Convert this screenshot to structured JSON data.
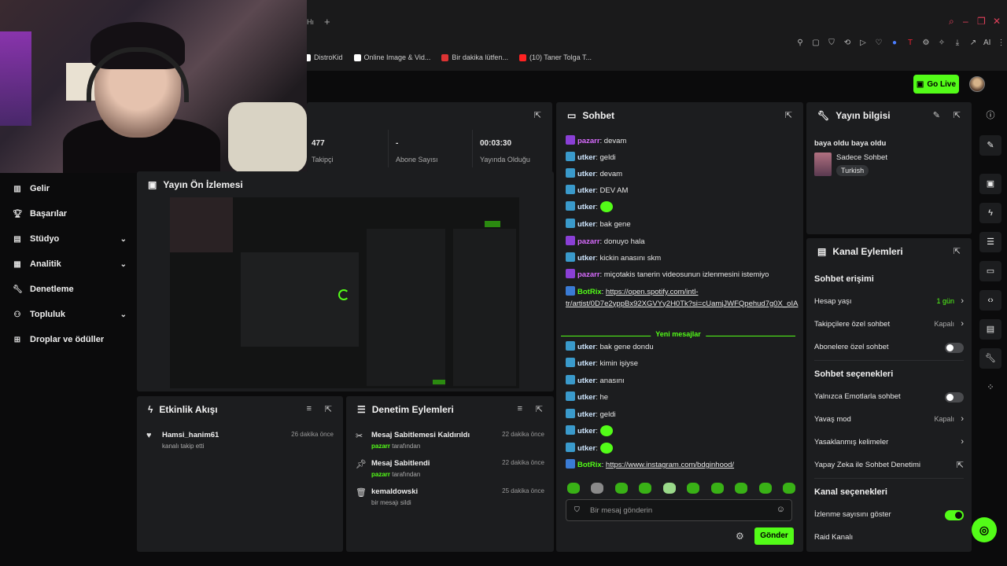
{
  "browser": {
    "tab_label": "Hı",
    "bookmarks": [
      {
        "label": "DistroKid",
        "color": "#ffffff"
      },
      {
        "label": "Online Image & Vid...",
        "color": "#ffffff"
      },
      {
        "label": "Bir dakika lütfen...",
        "color": "#d33"
      },
      {
        "label": "(10) Taner Tolga T...",
        "color": "#f22"
      }
    ],
    "toolbar_ai": "AI"
  },
  "header": {
    "go_live": "Go Live"
  },
  "nav": {
    "items": [
      {
        "label": "Gelir",
        "icon": "bar-chart-icon",
        "expand": false
      },
      {
        "label": "Başarılar",
        "icon": "trophy-icon",
        "expand": false
      },
      {
        "label": "Stüdyo",
        "icon": "studio-icon",
        "expand": true
      },
      {
        "label": "Analitik",
        "icon": "analytics-icon",
        "expand": true
      },
      {
        "label": "Denetleme",
        "icon": "wrench-icon",
        "expand": false
      },
      {
        "label": "Topluluk",
        "icon": "community-icon",
        "expand": true
      },
      {
        "label": "Droplar ve ödüller",
        "icon": "gift-icon",
        "expand": false
      }
    ]
  },
  "stats": {
    "followers_value": "477",
    "followers_label": "Takipçi",
    "subs_value": "-",
    "subs_label": "Abone Sayısı",
    "live_value": "00:03:30",
    "live_label": "Yayında Olduğu"
  },
  "preview": {
    "title": "Yayın Ön İzlemesi"
  },
  "events": {
    "title": "Etkinlik Akışı",
    "rows": [
      {
        "title": "Hamsi_hanim61",
        "sub": "kanalı takip etti",
        "time": "26 dakika önce"
      }
    ]
  },
  "modlog": {
    "title": "Denetim Eylemleri",
    "by_suffix": "tarafından",
    "rows": [
      {
        "title": "Mesaj Sabitlemesi Kaldırıldı",
        "user": "pazarr",
        "time": "22 dakika önce"
      },
      {
        "title": "Mesaj Sabitlendi",
        "user": "pazarr",
        "time": "22 dakika önce"
      },
      {
        "title": "kemaldowski",
        "sub": "bir mesajı sildi",
        "time": "25 dakika önce"
      }
    ]
  },
  "chat": {
    "title": "Sohbet",
    "messages": [
      {
        "user": "pazarr",
        "color": "#d96cff",
        "text": "devam"
      },
      {
        "user": "utker",
        "color": "#cfe7ff",
        "text": "geldi"
      },
      {
        "user": "utker",
        "color": "#cfe7ff",
        "text": "devam"
      },
      {
        "user": "utker",
        "color": "#cfe7ff",
        "text": "DEV AM"
      },
      {
        "user": "utker",
        "color": "#cfe7ff",
        "text": ""
      },
      {
        "user": "utker",
        "color": "#cfe7ff",
        "text": "bak gene"
      },
      {
        "user": "pazarr",
        "color": "#d96cff",
        "text": "donuyo hala"
      },
      {
        "user": "utker",
        "color": "#cfe7ff",
        "text": "kickin anasını skm"
      },
      {
        "user": "pazarr",
        "color": "#d96cff",
        "text": "miçotakis tanerin videosunun izlenmesini istemiyo"
      },
      {
        "user": "BotRix",
        "color": "#53fc18",
        "text": "https://open.spotify.com/intl-tr/artist/0D7e2yppBx92XGVYy2H0Tk?si=cUamjJWFQpehud7g0X_oIA"
      },
      {
        "user": "utker",
        "color": "#cfe7ff",
        "text": "bak gene dondu"
      },
      {
        "user": "utker",
        "color": "#cfe7ff",
        "text": "kimin işiyse"
      },
      {
        "user": "utker",
        "color": "#cfe7ff",
        "text": "anasını"
      },
      {
        "user": "utker",
        "color": "#cfe7ff",
        "text": "he"
      },
      {
        "user": "utker",
        "color": "#cfe7ff",
        "text": "geldi"
      },
      {
        "user": "utker",
        "color": "#cfe7ff",
        "text": ""
      },
      {
        "user": "utker",
        "color": "#cfe7ff",
        "text": ""
      },
      {
        "user": "BotRix",
        "color": "#53fc18",
        "text": "https://www.instagram.com/bdginhood/"
      }
    ],
    "new_messages": "Yeni mesajlar",
    "placeholder": "Bir mesaj gönderin",
    "send": "Gönder"
  },
  "info": {
    "title": "Yayın bilgisi",
    "stream_title": "baya oldu baya oldu",
    "category": "Sadece Sohbet",
    "tag": "Turkish"
  },
  "actions": {
    "title": "Kanal Eylemleri",
    "chat_access": "Sohbet erişimi",
    "account_age": "Hesap yaşı",
    "account_age_value": "1 gün",
    "followers_only": "Takipçilere özel sohbet",
    "followers_only_value": "Kapalı",
    "subs_only": "Abonelere özel sohbet",
    "chat_options": "Sohbet seçenekleri",
    "emote_only": "Yalnızca Emotlarla sohbet",
    "slow_mode": "Yavaş mod",
    "slow_mode_value": "Kapalı",
    "banned_words": "Yasaklanmış kelimeler",
    "ai_moderation": "Yapay Zeka ile Sohbet Denetimi",
    "channel_options": "Kanal seçenekleri",
    "show_viewers": "İzlenme sayısını göster",
    "raid": "Raid Kanalı"
  },
  "colors": {
    "accent": "#53fc18",
    "panel": "#1c1d1f",
    "bg": "#0b0b0c"
  }
}
